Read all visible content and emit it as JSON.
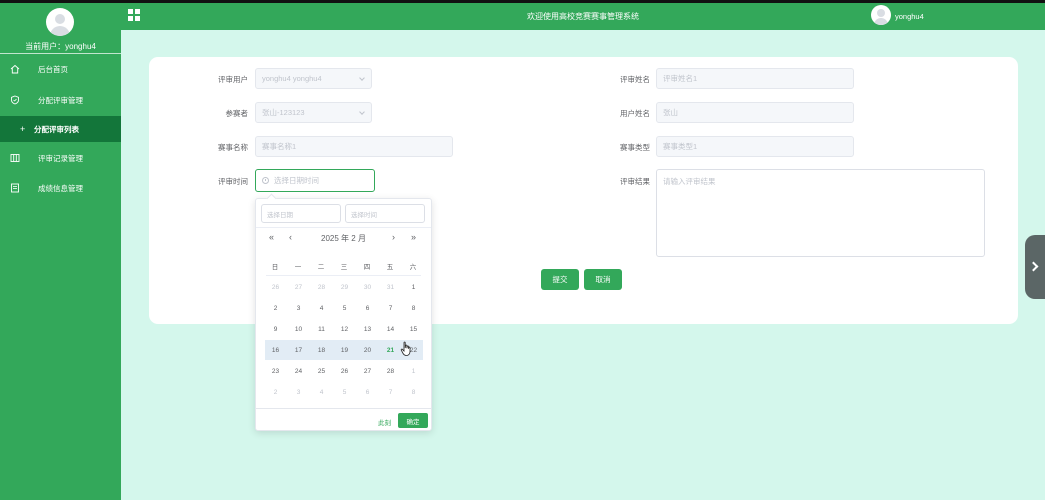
{
  "sidebar": {
    "current_user_label": "当前用户：",
    "current_user": "yonghu4",
    "items": [
      {
        "label": "后台首页",
        "icon": "home-icon"
      },
      {
        "label": "分配评审管理",
        "icon": "shield-icon"
      },
      {
        "label": "分配评审列表",
        "icon": "plus-icon"
      },
      {
        "label": "评审记录管理",
        "icon": "columns-icon"
      },
      {
        "label": "成绩信息管理",
        "icon": "document-icon"
      }
    ]
  },
  "header": {
    "title": "欢迎使用高校竞赛赛事管理系统",
    "username": "yonghu4"
  },
  "form": {
    "reviewer_user": {
      "label": "评审用户",
      "value": "yonghu4 yonghu4"
    },
    "reviewer_name": {
      "label": "评审姓名",
      "placeholder": "评审姓名1"
    },
    "participant": {
      "label": "参赛者",
      "value": "张山-123123"
    },
    "user_name": {
      "label": "用户姓名",
      "placeholder": "张山"
    },
    "event_name": {
      "label": "赛事名称",
      "placeholder": "赛事名称1"
    },
    "event_type": {
      "label": "赛事类型",
      "placeholder": "赛事类型1"
    },
    "review_time": {
      "label": "评审时间",
      "placeholder": "选择日期时间"
    },
    "review_result": {
      "label": "评审结果",
      "placeholder": "请输入评审结果"
    },
    "submit_label": "提交",
    "cancel_label": "取消"
  },
  "datepicker": {
    "date_placeholder": "选择日期",
    "time_placeholder": "选择时间",
    "nav": {
      "prev_year": "«",
      "prev_month": "‹",
      "next_month": "›",
      "next_year": "»"
    },
    "title": "2025 年  2 月",
    "weekdays": [
      "日",
      "一",
      "二",
      "三",
      "四",
      "五",
      "六"
    ],
    "weeks": [
      [
        "26",
        "27",
        "28",
        "29",
        "30",
        "31",
        "1"
      ],
      [
        "2",
        "3",
        "4",
        "5",
        "6",
        "7",
        "8"
      ],
      [
        "9",
        "10",
        "11",
        "12",
        "13",
        "14",
        "15"
      ],
      [
        "16",
        "17",
        "18",
        "19",
        "20",
        "21",
        "22"
      ],
      [
        "23",
        "24",
        "25",
        "26",
        "27",
        "28",
        "1"
      ],
      [
        "2",
        "3",
        "4",
        "5",
        "6",
        "7",
        "8"
      ]
    ],
    "now_label": "此刻",
    "confirm_label": "确定"
  },
  "colors": {
    "primary": "#33a85a",
    "sidebar_active": "#13763a",
    "background": "#d4f7ec",
    "selected_week_row": "#e2ecf5"
  }
}
